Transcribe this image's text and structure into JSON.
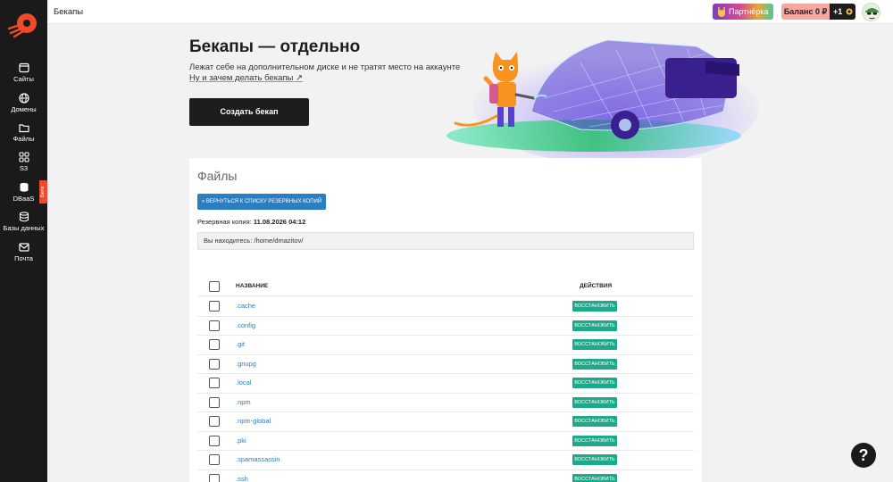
{
  "sidebar": {
    "items": [
      {
        "label": "Сайты",
        "icon": "browser-icon"
      },
      {
        "label": "Домены",
        "icon": "globe-icon"
      },
      {
        "label": "Файлы",
        "icon": "folder-icon"
      },
      {
        "label": "S3",
        "icon": "grid-icon"
      },
      {
        "label": "DBaaS",
        "icon": "database-icon"
      },
      {
        "label": "Базы данных",
        "icon": "database-stack-icon"
      },
      {
        "label": "Почта",
        "icon": "mail-icon"
      }
    ],
    "beta_tag": "Бета"
  },
  "topbar": {
    "title": "Бекапы",
    "partner_label": "Партнёрка",
    "balance_label": "Баланс 0 ₽",
    "bonus_label": "+1"
  },
  "hero": {
    "title": "Бекапы — отдельно",
    "subtitle": "Лежат себе на дополнительном диске и не тратят место на аккаунте",
    "link": "Ну и зачем делать бекапы ↗",
    "create_button": "Создать бекап"
  },
  "files": {
    "title": "Файлы",
    "back_button": "« ВЕРНУТЬСЯ К СПИСКУ РЕЗЕРВНЫХ КОПИЙ",
    "backup_label": "Резервная копия:",
    "backup_date": "11.08.2026 04:12",
    "path_text": "Вы находитесь: /home/dmazitov/",
    "columns": {
      "name": "НАЗВАНИЕ",
      "actions": "ДЕЙСТВИЯ"
    },
    "restore_label": "ВОССТАНОВИТЬ",
    "rows": [
      {
        "name": ".cache"
      },
      {
        "name": ".config"
      },
      {
        "name": ".git"
      },
      {
        "name": ".gnupg"
      },
      {
        "name": ".local"
      },
      {
        "name": ".npm"
      },
      {
        "name": ".npm-global"
      },
      {
        "name": ".pki"
      },
      {
        "name": ".spamassassin"
      },
      {
        "name": ".ssh"
      }
    ]
  },
  "help": {
    "label": "?"
  },
  "colors": {
    "accent": "#f04a2a",
    "sidebar_bg": "#1a1a1a",
    "link_blue": "#2a7ec3",
    "restore_green": "#1eaa8a"
  }
}
